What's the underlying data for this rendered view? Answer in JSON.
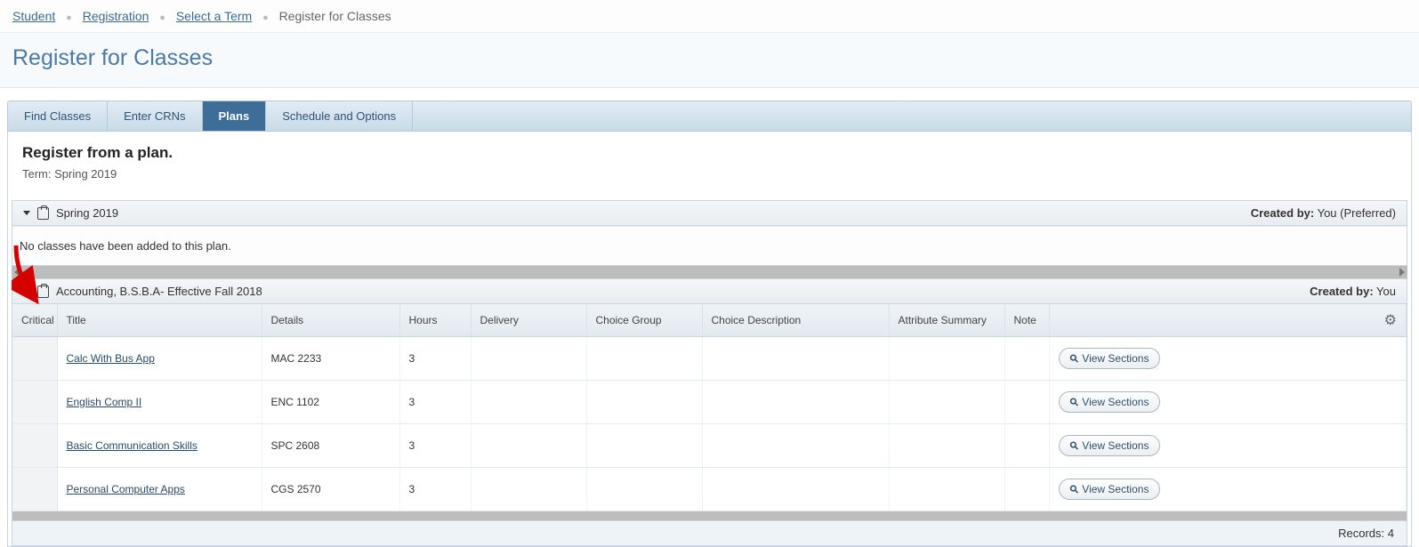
{
  "breadcrumb": {
    "items": [
      {
        "label": "Student",
        "link": true
      },
      {
        "label": "Registration",
        "link": true
      },
      {
        "label": "Select a Term",
        "link": true
      },
      {
        "label": "Register for Classes",
        "link": false
      }
    ]
  },
  "page_title": "Register for Classes",
  "tabs": {
    "items": [
      {
        "label": "Find Classes",
        "active": false
      },
      {
        "label": "Enter CRNs",
        "active": false
      },
      {
        "label": "Plans",
        "active": true
      },
      {
        "label": "Schedule and Options",
        "active": false
      }
    ]
  },
  "plan_intro": {
    "heading": "Register from a plan.",
    "term_label": "Term: Spring 2019"
  },
  "plan1": {
    "title": "Spring 2019",
    "created_label": "Created by:",
    "created_value": " You (Preferred)",
    "empty_msg": "No classes have been added to this plan."
  },
  "plan2": {
    "title": "Accounting, B.S.B.A- Effective Fall 2018",
    "created_label": "Created by:",
    "created_value": " You",
    "columns": {
      "crit": "Critical In",
      "title": "Title",
      "details": "Details",
      "hours": "Hours",
      "delivery": "Delivery",
      "choice_group": "Choice Group",
      "choice_desc": "Choice Description",
      "attr": "Attribute Summary",
      "note": "Note"
    },
    "rows": [
      {
        "title": "Calc With Bus App",
        "details": "MAC 2233",
        "hours": "3",
        "action": "View Sections"
      },
      {
        "title": "English Comp II",
        "details": "ENC 1102",
        "hours": "3",
        "action": "View Sections"
      },
      {
        "title": "Basic Communication Skills",
        "details": "SPC 2608",
        "hours": "3",
        "action": "View Sections"
      },
      {
        "title": "Personal Computer Apps",
        "details": "CGS 2570",
        "hours": "3",
        "action": "View Sections"
      }
    ],
    "records_label": "Records: 4"
  },
  "icons": {
    "search_glyph": "⚲",
    "gear_glyph": "⚙"
  }
}
